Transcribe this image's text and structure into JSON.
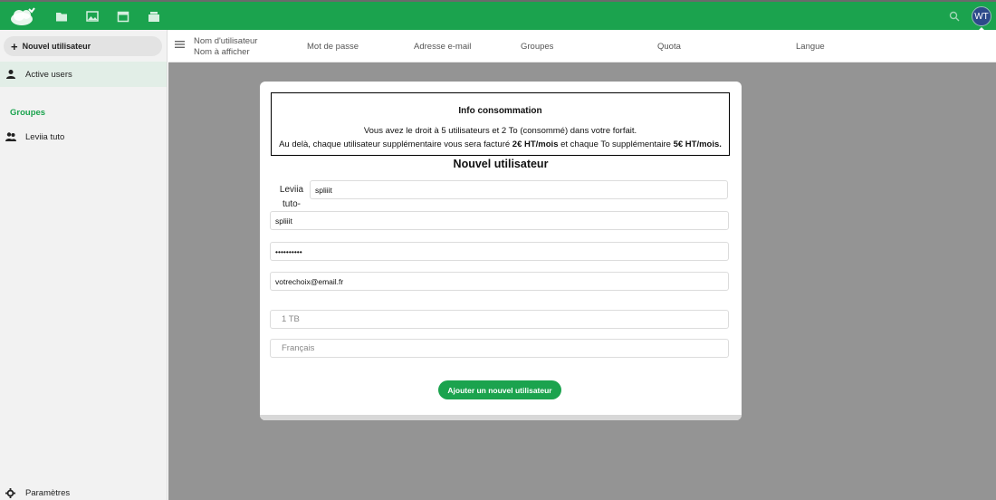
{
  "topbar": {
    "avatar_initials": "WT",
    "apps": [
      "files-icon",
      "photos-icon",
      "calendar-icon",
      "deck-icon"
    ],
    "accent": "#1ba34e"
  },
  "sidebar": {
    "new_user_label": "Nouvel utilisateur",
    "active_users_label": "Active users",
    "groups_caption": "Groupes",
    "group_item_label": "Leviia tuto",
    "settings_label": "Paramètres"
  },
  "columns": {
    "username_line1": "Nom d'utilisateur",
    "username_line2": "Nom à afficher",
    "password": "Mot de passe",
    "email": "Adresse e-mail",
    "groups": "Groupes",
    "quota": "Quota",
    "language": "Langue"
  },
  "modal": {
    "info": {
      "title": "Info consommation",
      "line1": "Vous avez le droit à 5 utilisateurs et 2 To (consommé) dans votre forfait.",
      "line2_a": "Au delà, chaque utilisateur supplémentaire vous sera facturé ",
      "line2_b": "2€ HT/mois",
      "line2_c": " et chaque To supplémentaire ",
      "line2_d": "5€ HT/mois."
    },
    "title": "Nouvel utilisateur",
    "group_label": "Leviia tuto-",
    "fields": {
      "username": "spliiit",
      "display_name": "spliiit",
      "password": "••••••••••",
      "email": "votrechoix@email.fr",
      "quota_placeholder": "1 TB",
      "language_placeholder": "Français"
    },
    "submit_label": "Ajouter un nouvel utilisateur"
  }
}
